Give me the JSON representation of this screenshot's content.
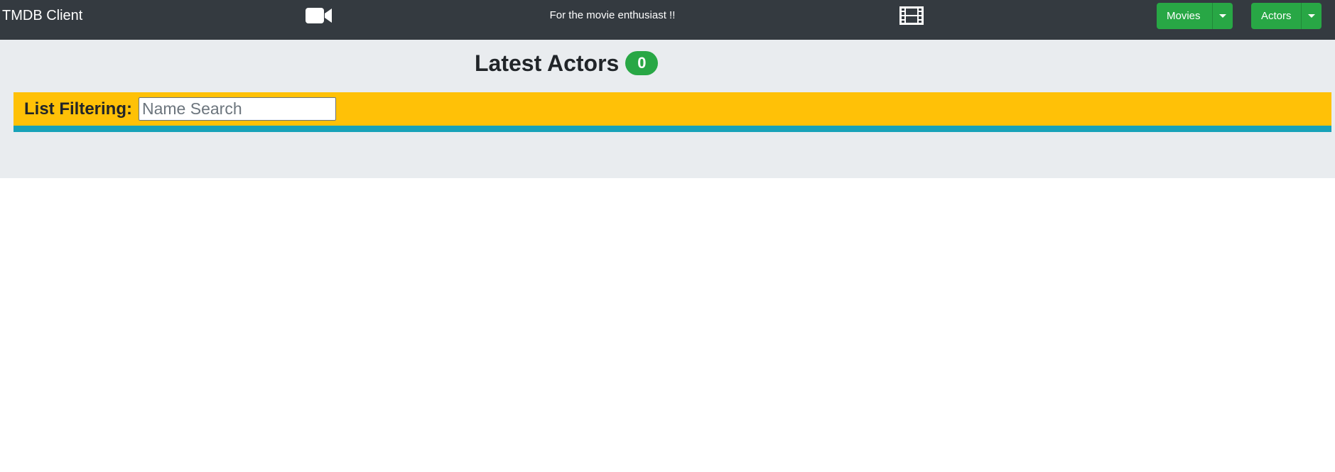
{
  "navbar": {
    "brand": "TMDB Client",
    "tagline": "For the movie enthusiast !!",
    "left_icon": "video-camera-icon",
    "right_icon": "film-icon",
    "movies_label": "Movies",
    "actors_label": "Actors",
    "background_color": "#343a40",
    "button_color": "#28a745"
  },
  "main": {
    "title": "Latest Actors",
    "count": "0",
    "filter": {
      "label": "List Filtering:",
      "placeholder": "Name Search",
      "value": ""
    },
    "colors": {
      "filter_bar": "#ffc107",
      "info_line": "#17a2b8",
      "background": "#e9ecef"
    }
  }
}
